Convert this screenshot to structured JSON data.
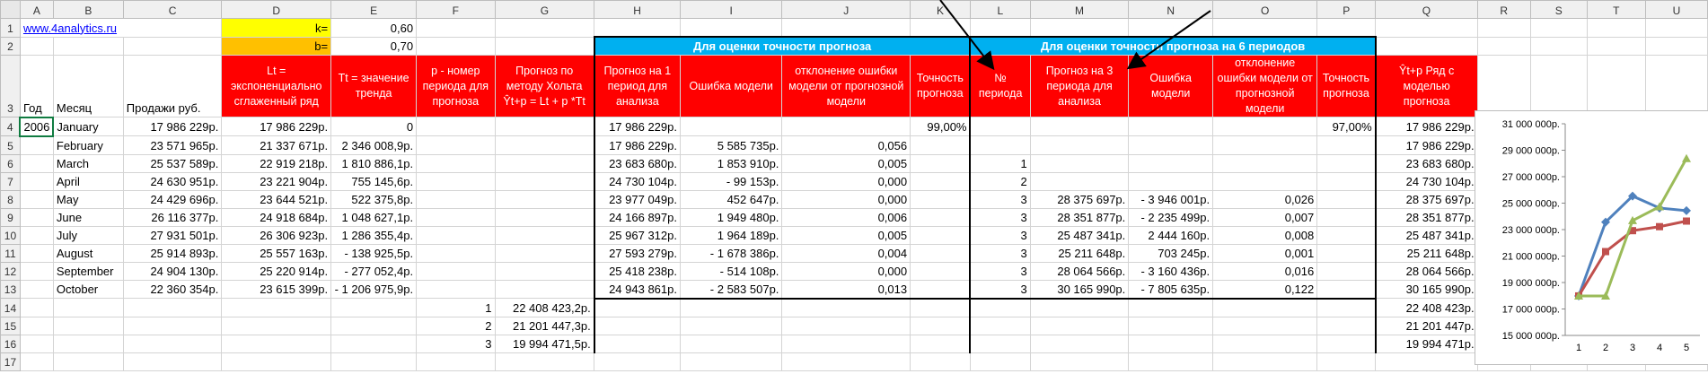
{
  "columns": [
    "A",
    "B",
    "C",
    "D",
    "E",
    "F",
    "G",
    "H",
    "I",
    "J",
    "K",
    "L",
    "M",
    "N",
    "O",
    "P",
    "Q",
    "R",
    "S",
    "T",
    "U"
  ],
  "rows": [
    "1",
    "2",
    "3",
    "4",
    "5",
    "6",
    "7",
    "8",
    "9",
    "10",
    "11",
    "12",
    "13",
    "14",
    "15",
    "16",
    "17"
  ],
  "site_link": "www.4analytics.ru",
  "params": {
    "k_label": "k=",
    "k_value": "0,60",
    "b_label": "b=",
    "b_value": "0,70"
  },
  "banners": {
    "accuracy": "Для оценки точности прогноза",
    "accuracy6": "Для оценки точности прогноза на 6 периодов"
  },
  "headers": {
    "A": "Год",
    "B": "Месяц",
    "C": "Продажи руб.",
    "D": "Lt = экспоненциально сглаженный ряд",
    "E": "Tt = значение тренда",
    "F": "p - номер периода для прогноза",
    "G": "Прогноз по методу Хольта Ŷt+p = Lt + p *Tt",
    "H": "Прогноз на 1 период для анализа",
    "I": "Ошибка модели",
    "J": "отклонение ошибки модели от прогнозной модели",
    "K": "Точность прогноза",
    "L": "№ периода",
    "M": "Прогноз на 3 периода для анализа",
    "N": "Ошибка модели",
    "O": "отклонение ошибки модели от прогнозной модели",
    "P": "Точность прогноза",
    "Q": "Ŷt+p Ряд с моделью прогноза"
  },
  "data_rows": [
    {
      "A": "2006",
      "B": "January",
      "C": "17 986 229р.",
      "D": "17 986 229р.",
      "E": "0",
      "F": "",
      "G": "",
      "H": "17 986 229р.",
      "I": "",
      "J": "",
      "K": "99,00%",
      "L": "",
      "M": "",
      "N": "",
      "O": "",
      "P": "97,00%",
      "Q": "17 986 229р."
    },
    {
      "A": "",
      "B": "February",
      "C": "23 571 965р.",
      "D": "21 337 671р.",
      "E": "2 346 008,9р.",
      "F": "",
      "G": "",
      "H": "17 986 229р.",
      "I": "5 585 735р.",
      "J": "0,056",
      "K": "",
      "L": "",
      "M": "",
      "N": "",
      "O": "",
      "P": "",
      "Q": "17 986 229р."
    },
    {
      "A": "",
      "B": "March",
      "C": "25 537 589р.",
      "D": "22 919 218р.",
      "E": "1 810 886,1р.",
      "F": "",
      "G": "",
      "H": "23 683 680р.",
      "I": "1 853 910р.",
      "J": "0,005",
      "K": "",
      "L": "1",
      "M": "",
      "N": "",
      "O": "",
      "P": "",
      "Q": "23 683 680р."
    },
    {
      "A": "",
      "B": "April",
      "C": "24 630 951р.",
      "D": "23 221 904р.",
      "E": "755 145,6р.",
      "F": "",
      "G": "",
      "H": "24 730 104р.",
      "I": "- 99 153р.",
      "J": "0,000",
      "K": "",
      "L": "2",
      "M": "",
      "N": "",
      "O": "",
      "P": "",
      "Q": "24 730 104р."
    },
    {
      "A": "",
      "B": "May",
      "C": "24 429 696р.",
      "D": "23 644 521р.",
      "E": "522 375,8р.",
      "F": "",
      "G": "",
      "H": "23 977 049р.",
      "I": "452 647р.",
      "J": "0,000",
      "K": "",
      "L": "3",
      "M": "28 375 697р.",
      "N": "- 3 946 001р.",
      "O": "0,026",
      "P": "",
      "Q": "28 375 697р."
    },
    {
      "A": "",
      "B": "June",
      "C": "26 116 377р.",
      "D": "24 918 684р.",
      "E": "1 048 627,1р.",
      "F": "",
      "G": "",
      "H": "24 166 897р.",
      "I": "1 949 480р.",
      "J": "0,006",
      "K": "",
      "L": "3",
      "M": "28 351 877р.",
      "N": "- 2 235 499р.",
      "O": "0,007",
      "P": "",
      "Q": "28 351 877р."
    },
    {
      "A": "",
      "B": "July",
      "C": "27 931 501р.",
      "D": "26 306 923р.",
      "E": "1 286 355,4р.",
      "F": "",
      "G": "",
      "H": "25 967 312р.",
      "I": "1 964 189р.",
      "J": "0,005",
      "K": "",
      "L": "3",
      "M": "25 487 341р.",
      "N": "2 444 160р.",
      "O": "0,008",
      "P": "",
      "Q": "25 487 341р."
    },
    {
      "A": "",
      "B": "August",
      "C": "25 914 893р.",
      "D": "25 557 163р.",
      "E": "- 138 925,5р.",
      "F": "",
      "G": "",
      "H": "27 593 279р.",
      "I": "- 1 678 386р.",
      "J": "0,004",
      "K": "",
      "L": "3",
      "M": "25 211 648р.",
      "N": "703 245р.",
      "O": "0,001",
      "P": "",
      "Q": "25 211 648р."
    },
    {
      "A": "",
      "B": "September",
      "C": "24 904 130р.",
      "D": "25 220 914р.",
      "E": "- 277 052,4р.",
      "F": "",
      "G": "",
      "H": "25 418 238р.",
      "I": "- 514 108р.",
      "J": "0,000",
      "K": "",
      "L": "3",
      "M": "28 064 566р.",
      "N": "- 3 160 436р.",
      "O": "0,016",
      "P": "",
      "Q": "28 064 566р."
    },
    {
      "A": "",
      "B": "October",
      "C": "22 360 354р.",
      "D": "23 615 399р.",
      "E": "- 1 206 975,9р.",
      "F": "",
      "G": "",
      "H": "24 943 861р.",
      "I": "- 2 583 507р.",
      "J": "0,013",
      "K": "",
      "L": "3",
      "M": "30 165 990р.",
      "N": "- 7 805 635р.",
      "O": "0,122",
      "P": "",
      "Q": "30 165 990р."
    },
    {
      "A": "",
      "B": "",
      "C": "",
      "D": "",
      "E": "",
      "F": "1",
      "G": "22 408 423,2р.",
      "H": "",
      "I": "",
      "J": "",
      "K": "",
      "L": "",
      "M": "",
      "N": "",
      "O": "",
      "P": "",
      "Q": "22 408 423р."
    },
    {
      "A": "",
      "B": "",
      "C": "",
      "D": "",
      "E": "",
      "F": "2",
      "G": "21 201 447,3р.",
      "H": "",
      "I": "",
      "J": "",
      "K": "",
      "L": "",
      "M": "",
      "N": "",
      "O": "",
      "P": "",
      "Q": "21 201 447р."
    },
    {
      "A": "",
      "B": "",
      "C": "",
      "D": "",
      "E": "",
      "F": "3",
      "G": "19 994 471,5р.",
      "H": "",
      "I": "",
      "J": "",
      "K": "",
      "L": "",
      "M": "",
      "N": "",
      "O": "",
      "P": "",
      "Q": "19 994 471р."
    },
    {
      "A": "",
      "B": "",
      "C": "",
      "D": "",
      "E": "",
      "F": "",
      "G": "",
      "H": "",
      "I": "",
      "J": "",
      "K": "",
      "L": "",
      "M": "",
      "N": "",
      "O": "",
      "P": "",
      "Q": ""
    }
  ],
  "chart_data": {
    "type": "line",
    "x": [
      1,
      2,
      3,
      4,
      5
    ],
    "ylim": [
      15000000,
      31000000
    ],
    "y_ticks": [
      "31 000 000р.",
      "29 000 000р.",
      "27 000 000р.",
      "25 000 000р.",
      "23 000 000р.",
      "21 000 000р.",
      "19 000 000р.",
      "17 000 000р.",
      "15 000 000р."
    ],
    "x_ticks": [
      "1",
      "2",
      "3",
      "4",
      "5"
    ],
    "series": [
      {
        "color": "#4f81bd",
        "values": [
          17986229,
          23571965,
          25537589,
          24630951,
          24429696
        ]
      },
      {
        "color": "#c0504d",
        "values": [
          17986229,
          21337671,
          22919218,
          23221904,
          23644521
        ]
      },
      {
        "color": "#9bbb59",
        "values": [
          17986229,
          17986229,
          23683680,
          24730104,
          28375697
        ]
      }
    ]
  }
}
